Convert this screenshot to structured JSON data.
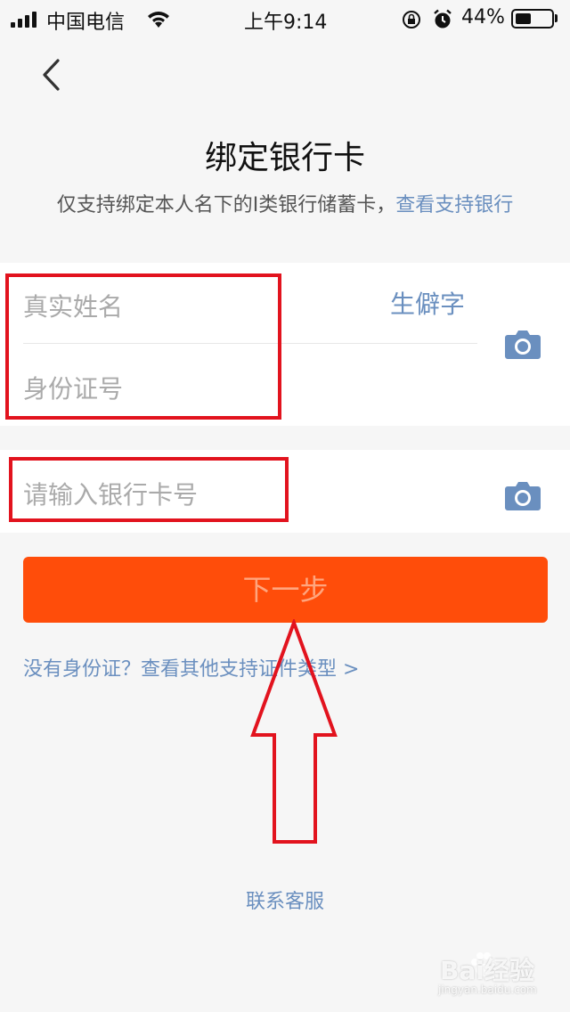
{
  "status_bar": {
    "carrier": "中国电信",
    "time": "上午9:14",
    "battery_percent": "44%",
    "battery_level": 0.44,
    "icons": [
      "signal-icon",
      "wifi-icon",
      "rotation-lock-icon",
      "alarm-icon",
      "battery-icon"
    ]
  },
  "header": {
    "back_icon": "chevron-left-icon",
    "title": "绑定银行卡",
    "subtitle": "仅支持绑定本人名下的I类银行储蓄卡，",
    "subtitle_link": "查看支持银行"
  },
  "form": {
    "name_placeholder": "真实姓名",
    "rare_char_label": "生僻字",
    "id_placeholder": "身份证号",
    "card_placeholder": "请输入银行卡号",
    "camera_icon": "camera-icon"
  },
  "actions": {
    "next_label": "下一步",
    "other_id_link": "没有身份证？查看其他支持证件类型 >",
    "contact_label": "联系客服"
  },
  "colors": {
    "accent": "#ff4d0a",
    "link": "#6a8fbf",
    "annotation": "#e2131e"
  },
  "watermark": {
    "text": "Bai经验",
    "sub": "jingyan.baidu.com"
  }
}
